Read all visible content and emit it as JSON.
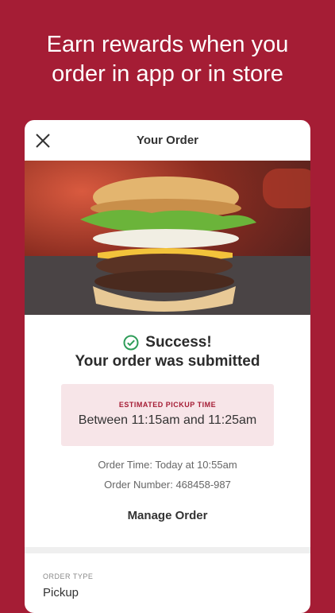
{
  "headline": {
    "line1": "Earn rewards when you",
    "line2": "order in app or in store"
  },
  "card": {
    "title": "Your Order",
    "success_title": "Success!",
    "success_subtitle": "Your order was submitted",
    "pickup": {
      "label": "ESTIMATED PICKUP TIME",
      "range": "Between 11:15am and 11:25am"
    },
    "order_time": "Order Time: Today at 10:55am",
    "order_number": "Order Number: 468458-987",
    "manage_label": "Manage Order",
    "order_type_label": "ORDER TYPE",
    "order_type_value": "Pickup"
  },
  "colors": {
    "brand": "#a51d35",
    "success": "#2e9c58",
    "pickup_bg": "#f7e5e8"
  },
  "icons": {
    "close": "close-icon",
    "success": "check-circle-icon"
  }
}
